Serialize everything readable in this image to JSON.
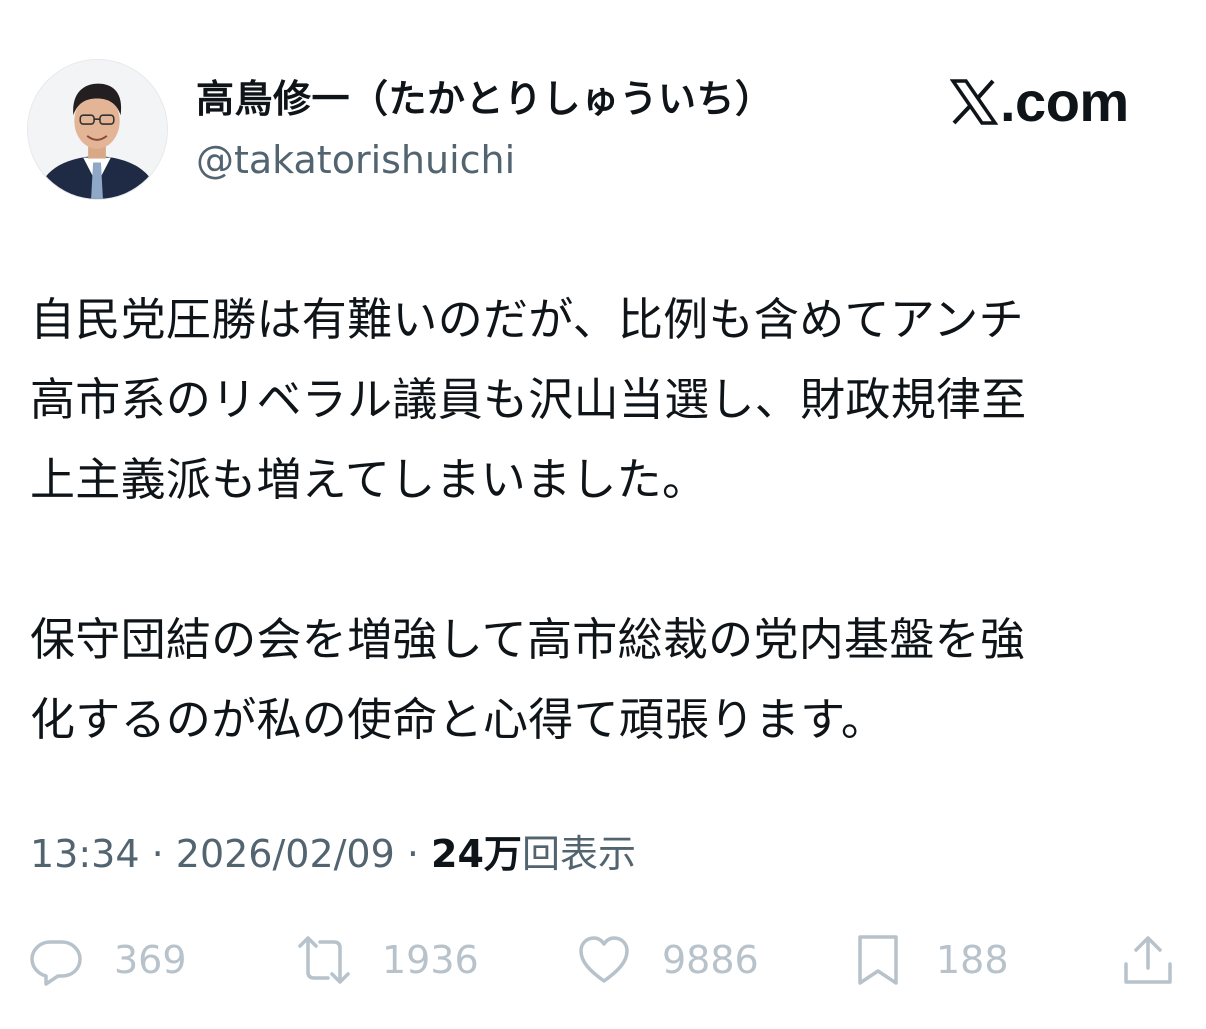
{
  "author": {
    "display_name": "高鳥修一（たかとりしゅういち）",
    "handle": "@takatorishuichi",
    "avatar_icon": "user-avatar-photo"
  },
  "brand": {
    "logo_icon": "x-logo-icon",
    "text": ".com"
  },
  "tweet": {
    "lines": [
      "自民党圧勝は有難いのだが、比例も含めてアンチ",
      "高市系のリベラル議員も沢山当選し、財政規律至",
      "上主義派も増えてしまいました。",
      "保守団結の会を増強して高市総裁の党内基盤を強",
      "化するのが私の使命と心得て頑張ります。"
    ]
  },
  "meta": {
    "time": "13:34",
    "separator": " · ",
    "date": "2026/02/09",
    "views_count": "24万",
    "views_label": "回表示"
  },
  "actions": {
    "reply": {
      "icon": "reply-icon",
      "count": "369"
    },
    "repost": {
      "icon": "repost-icon",
      "count": "1936"
    },
    "like": {
      "icon": "heart-icon",
      "count": "9886"
    },
    "bookmark": {
      "icon": "bookmark-icon",
      "count": "188"
    },
    "share": {
      "icon": "share-icon"
    }
  },
  "colors": {
    "text_primary": "#0f1419",
    "text_secondary": "#536471",
    "action_icons": "#b7c2cb"
  }
}
